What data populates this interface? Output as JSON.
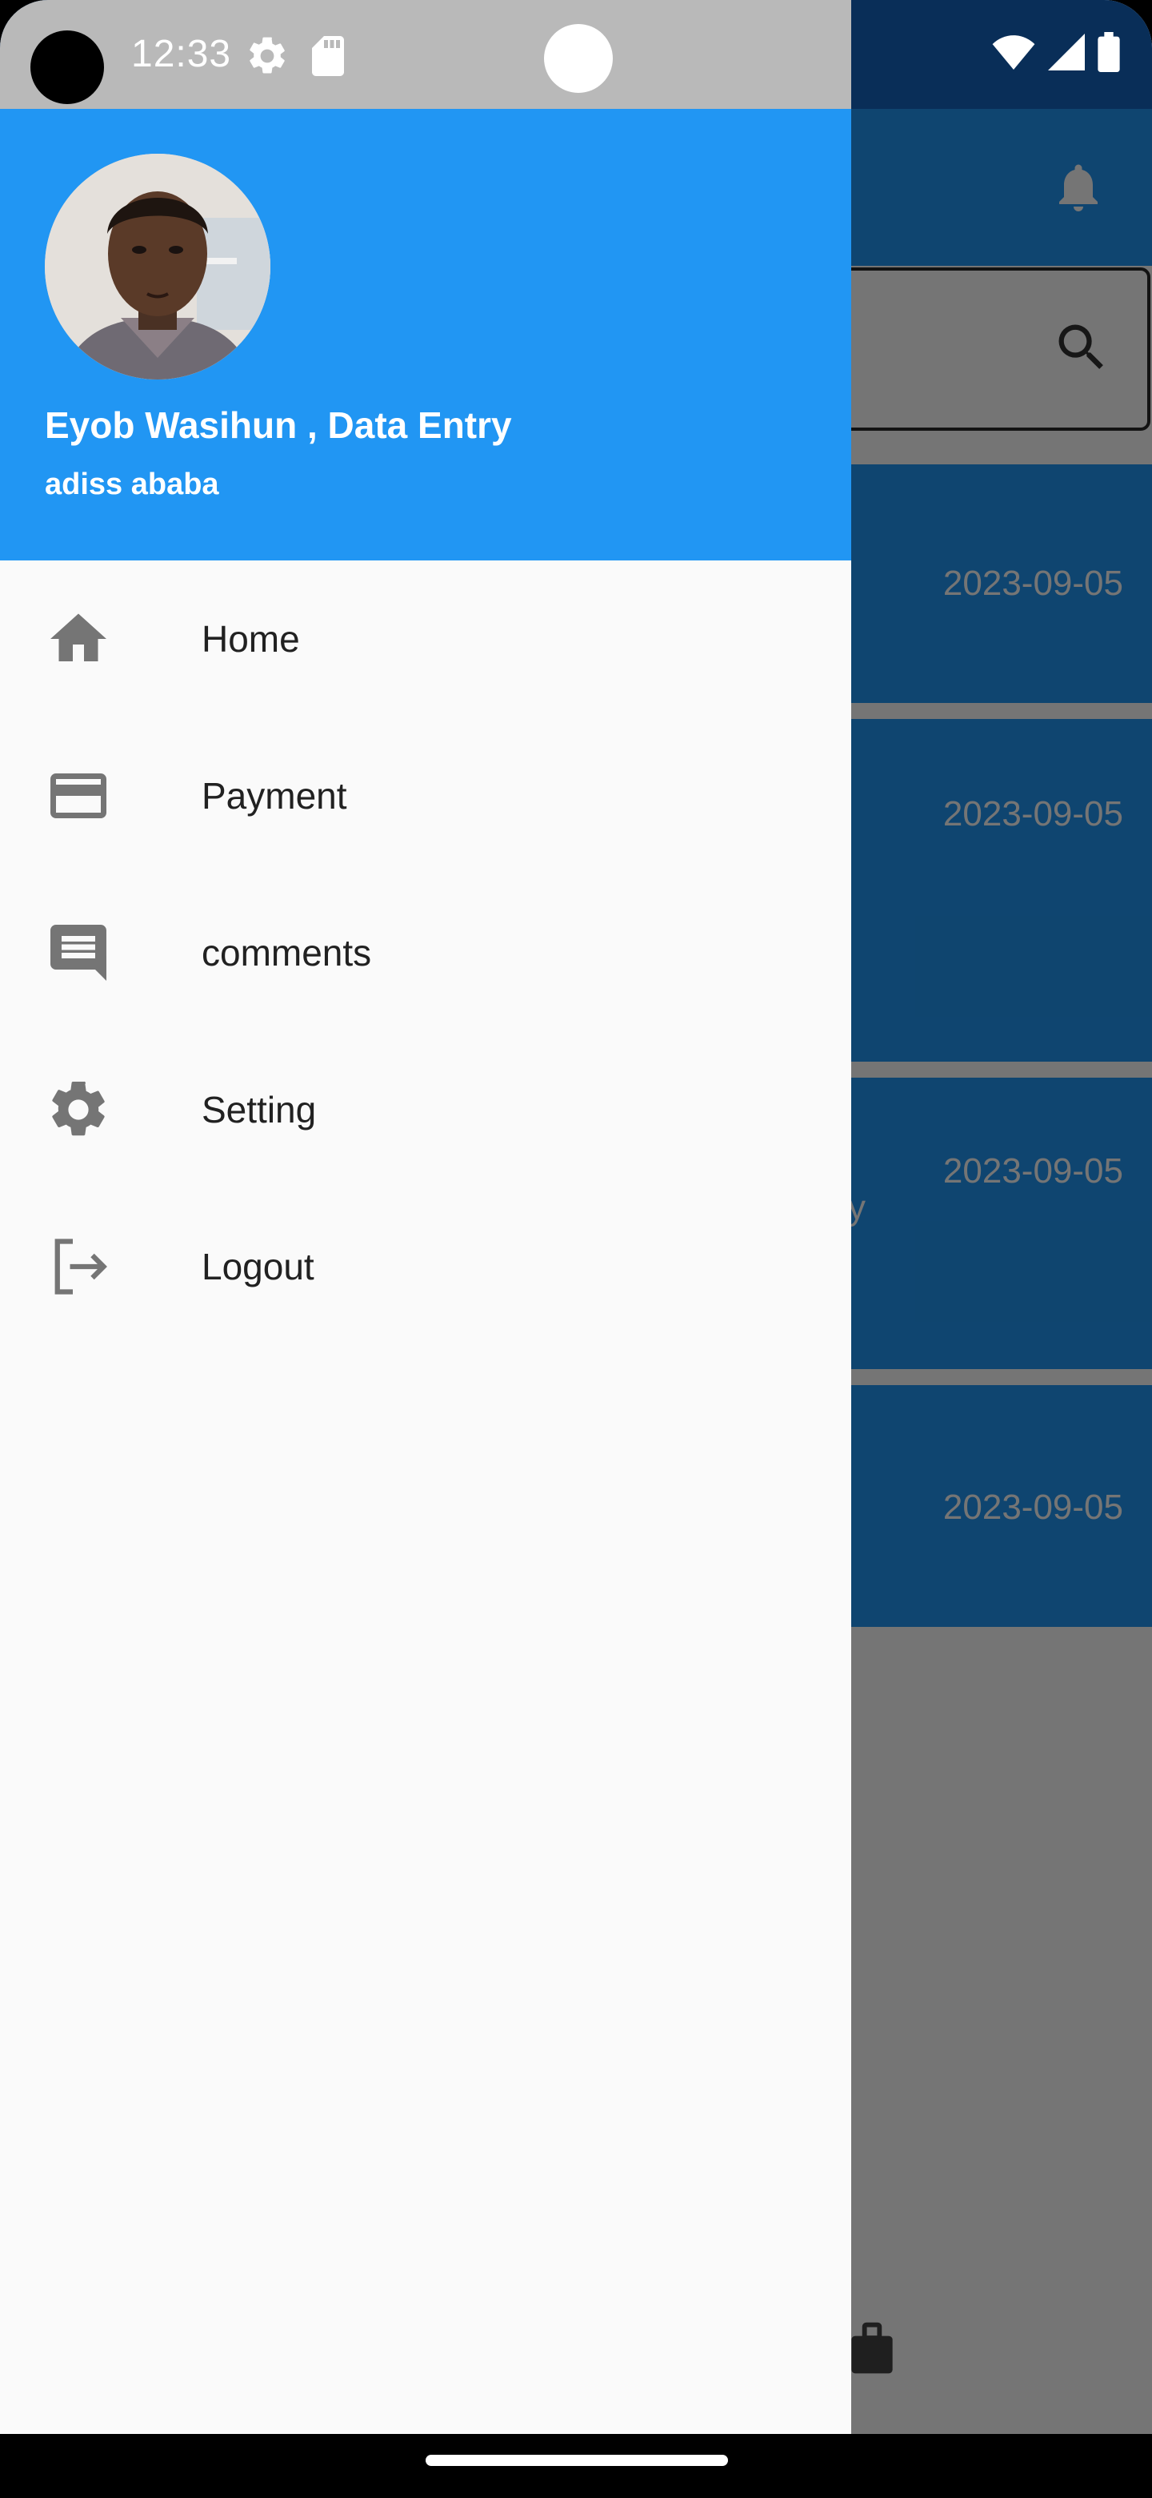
{
  "status_bar": {
    "time": "12:33"
  },
  "drawer": {
    "user_name": "Eyob Wasihun , Data Entry",
    "user_city": "adiss ababa",
    "menu": [
      {
        "label": "Home",
        "icon": "home-icon"
      },
      {
        "label": "Payment",
        "icon": "credit-card-icon"
      },
      {
        "label": "comments",
        "icon": "comment-icon"
      },
      {
        "label": "Setting",
        "icon": "gear-icon"
      },
      {
        "label": "Logout",
        "icon": "logout-icon"
      }
    ]
  },
  "background": {
    "cards": [
      {
        "date": "2023-09-05"
      },
      {
        "date": "2023-09-05"
      },
      {
        "date": "2023-09-05",
        "fragment": "y"
      },
      {
        "date": "2023-09-05"
      }
    ]
  },
  "colors": {
    "drawer_header": "#2196f3",
    "drawer_body": "#fafafa",
    "menu_icon": "#757575",
    "menu_text": "#212121"
  }
}
